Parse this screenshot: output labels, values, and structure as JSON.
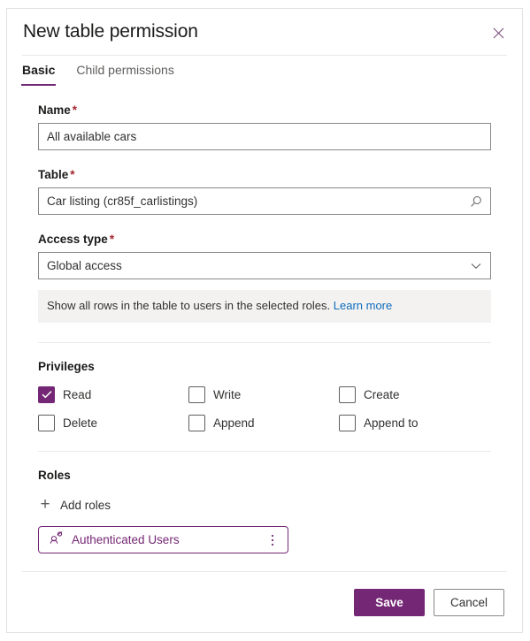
{
  "dialog": {
    "title": "New table permission",
    "close_icon": "close-icon"
  },
  "tabs": [
    {
      "label": "Basic",
      "active": true
    },
    {
      "label": "Child permissions",
      "active": false
    }
  ],
  "fields": {
    "name": {
      "label": "Name",
      "required_marker": "*",
      "value": "All available cars",
      "placeholder": ""
    },
    "table": {
      "label": "Table",
      "required_marker": "*",
      "value": "Car listing (cr85f_carlistings)",
      "placeholder": "",
      "icon": "search-icon"
    },
    "access_type": {
      "label": "Access type",
      "required_marker": "*",
      "value": "Global access",
      "icon": "chevron-down-icon",
      "hint_text": "Show all rows in the table to users in the selected roles.",
      "hint_link": "Learn more",
      "hint_link_color": "#0f6cbd"
    }
  },
  "privileges": {
    "title": "Privileges",
    "items": [
      {
        "label": "Read",
        "checked": true
      },
      {
        "label": "Write",
        "checked": false
      },
      {
        "label": "Create",
        "checked": false
      },
      {
        "label": "Delete",
        "checked": false
      },
      {
        "label": "Append",
        "checked": false
      },
      {
        "label": "Append to",
        "checked": false
      }
    ]
  },
  "roles": {
    "title": "Roles",
    "add_label": "Add roles",
    "add_icon": "plus-icon",
    "items": [
      {
        "name": "Authenticated Users",
        "icon": "person-icon",
        "menu_icon": "more-vertical-icon"
      }
    ]
  },
  "footer": {
    "save_label": "Save",
    "cancel_label": "Cancel"
  },
  "colors": {
    "accent": "#742774",
    "required": "#a4262c",
    "link": "#0f6cbd",
    "info_bg": "#f3f2f1"
  }
}
